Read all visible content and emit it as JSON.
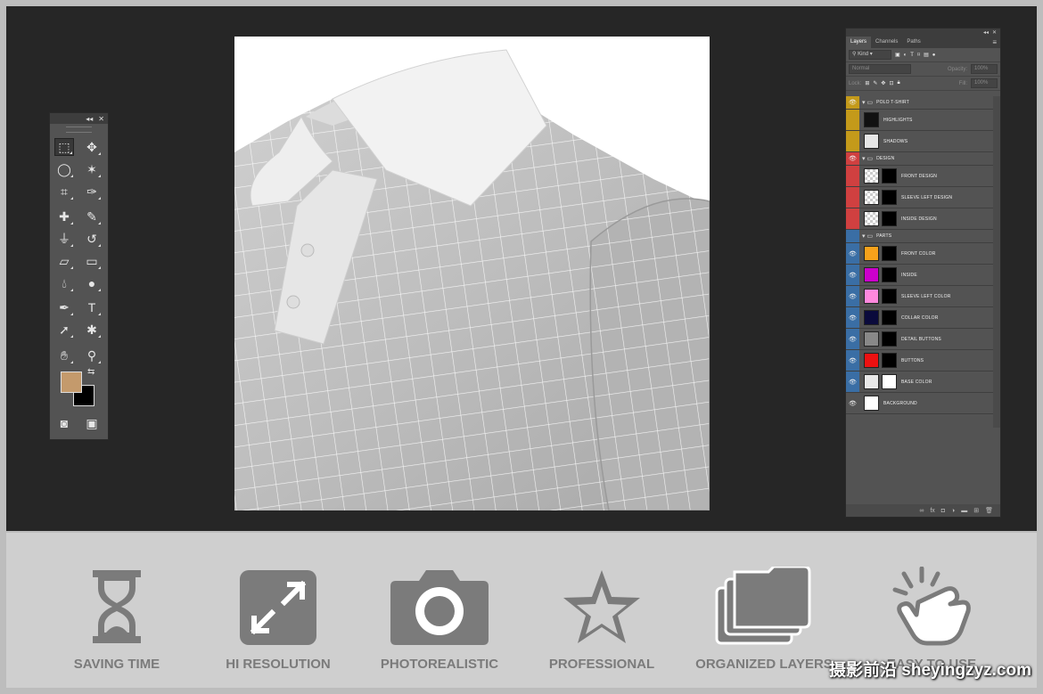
{
  "toolbox": {
    "collapse_glyph": "◂◂",
    "close_glyph": "✕",
    "foreground_color": "#c49a6c",
    "background_color": "#000000",
    "tools": [
      "marquee-tool-icon",
      "move-tool-icon",
      "lasso-tool-icon",
      "magic-wand-tool-icon",
      "crop-tool-icon",
      "eyedropper-tool-icon",
      "spot-healing-tool-icon",
      "brush-tool-icon",
      "clone-stamp-tool-icon",
      "history-brush-tool-icon",
      "eraser-tool-icon",
      "gradient-tool-icon",
      "blur-tool-icon",
      "dodge-tool-icon",
      "pen-tool-icon",
      "type-tool-icon",
      "path-selection-tool-icon",
      "custom-shape-tool-icon",
      "hand-tool-icon",
      "zoom-tool-icon",
      "quick-mask-icon",
      "screen-mode-icon"
    ],
    "type_glyph": "T"
  },
  "layers_panel": {
    "tabs": [
      "Layers",
      "Channels",
      "Paths"
    ],
    "filter_label": "Kind",
    "blend_mode": "Normal",
    "opacity_label": "Opacity:",
    "opacity_value": "100%",
    "lock_label": "Lock:",
    "fill_label": "Fill:",
    "fill_value": "100%",
    "layers": [
      {
        "name": "POLO T-SHIRT",
        "kind": "group",
        "tag": "#c49a1a",
        "visible": true
      },
      {
        "name": "HIGHLIGHTS",
        "kind": "layer",
        "tag": "#c49a1a",
        "visible": false,
        "thumb": "dark",
        "mask": false
      },
      {
        "name": "SHADOWS",
        "kind": "layer",
        "tag": "#c49a1a",
        "visible": false,
        "thumb": "light",
        "mask": false
      },
      {
        "name": "DESIGN",
        "kind": "group",
        "tag": "#d04040",
        "visible": true
      },
      {
        "name": "FRONT DESIGN",
        "kind": "layer",
        "tag": "#d04040",
        "visible": false,
        "thumb": "checker",
        "mask": true
      },
      {
        "name": "SLEEVE LEFT DESIGN",
        "kind": "layer",
        "tag": "#d04040",
        "visible": false,
        "thumb": "checker",
        "mask": true
      },
      {
        "name": "INSIDE DESIGN",
        "kind": "layer",
        "tag": "#d04040",
        "visible": false,
        "thumb": "checker",
        "mask": true
      },
      {
        "name": "PARTS",
        "kind": "group",
        "tag": "#3a6ea5",
        "visible": false
      },
      {
        "name": "FRONT COLOR",
        "kind": "layer",
        "tag": "#3a6ea5",
        "visible": true,
        "thumb": "#f7a21b",
        "mask": true
      },
      {
        "name": "INSIDE",
        "kind": "layer",
        "tag": "#3a6ea5",
        "visible": true,
        "thumb": "#cc00cc",
        "mask": true
      },
      {
        "name": "SLEEVE LEFT COLOR",
        "kind": "layer",
        "tag": "#3a6ea5",
        "visible": true,
        "thumb": "#ff88dd",
        "mask": true
      },
      {
        "name": "COLLAR COLOR",
        "kind": "layer",
        "tag": "#3a6ea5",
        "visible": true,
        "thumb": "#0a0a3c",
        "mask": true
      },
      {
        "name": "DETAIL BUTTONS",
        "kind": "layer",
        "tag": "#3a6ea5",
        "visible": true,
        "thumb": "#888888",
        "mask": true
      },
      {
        "name": "BUTTONS",
        "kind": "layer",
        "tag": "#3a6ea5",
        "visible": true,
        "thumb": "#ee1111",
        "mask": true
      },
      {
        "name": "BASE COLOR",
        "kind": "layer",
        "tag": "#3a6ea5",
        "visible": true,
        "thumb": "#e8e8e8",
        "mask": true
      },
      {
        "name": "BACKGROUND",
        "kind": "layer",
        "tag": "",
        "visible": true,
        "thumb": "#ffffff",
        "mask": false
      }
    ]
  },
  "features": [
    {
      "label": "SAVING TIME",
      "icon": "hourglass-icon"
    },
    {
      "label": "HI RESOLUTION",
      "icon": "expand-arrows-icon"
    },
    {
      "label": "PHOTOREALISTIC",
      "icon": "camera-icon"
    },
    {
      "label": "PROFESSIONAL",
      "icon": "star-icon"
    },
    {
      "label": "ORGANIZED LAYERS",
      "icon": "folders-icon"
    },
    {
      "label": "EASY TO USE",
      "icon": "click-hand-icon"
    }
  ],
  "watermark": "摄影前沿 sheyingzyz.com",
  "colors": {
    "workspace": "#262626",
    "panel": "#535353",
    "feature_gray": "#7b7b7b"
  }
}
